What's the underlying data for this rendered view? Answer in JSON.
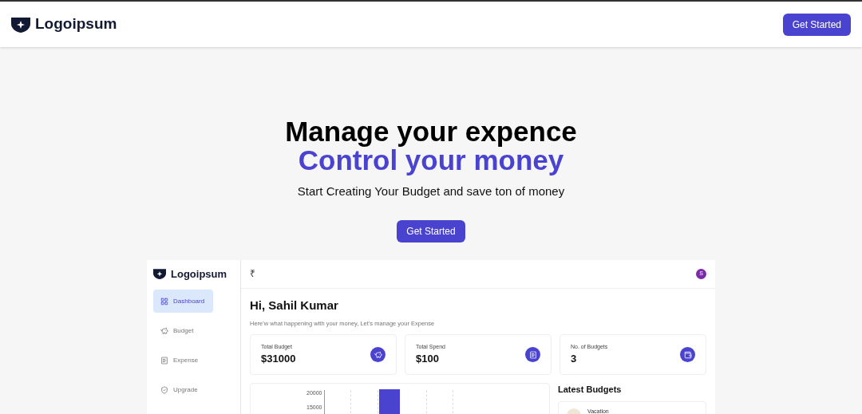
{
  "navbar": {
    "logo_text": "Logoipsum",
    "button": "Get Started"
  },
  "hero": {
    "title": "Manage your expence",
    "subtitle": "Control your money",
    "tagline": "Start Creating Your Budget and save ton of money",
    "button": "Get Started"
  },
  "preview": {
    "logo_text": "Logoipsum",
    "sidebar": [
      {
        "kind": "grid",
        "label": "Dashboard",
        "selected": true
      },
      {
        "kind": "piggy",
        "label": "Budget",
        "selected": false
      },
      {
        "kind": "receipt",
        "label": "Expense",
        "selected": false
      },
      {
        "kind": "shield",
        "label": "Upgrade",
        "selected": false
      }
    ],
    "currency": "₹",
    "avatar": "S",
    "greeting": "Hi, Sahil Kumar",
    "intro": "Here'w what happening with your money, Let's manage your Expense",
    "cards": [
      {
        "kind": "piggy",
        "label": "Total Budget",
        "value": "$31000"
      },
      {
        "kind": "receipt",
        "label": "Total Spend",
        "value": "$100"
      },
      {
        "kind": "wallet",
        "label": "No. of Budgets",
        "value": "3"
      }
    ],
    "chart_ticks": [
      "20000",
      "15000"
    ],
    "latest_title": "Latest Budgets",
    "latest": [
      {
        "name": "Vacation"
      }
    ]
  }
}
